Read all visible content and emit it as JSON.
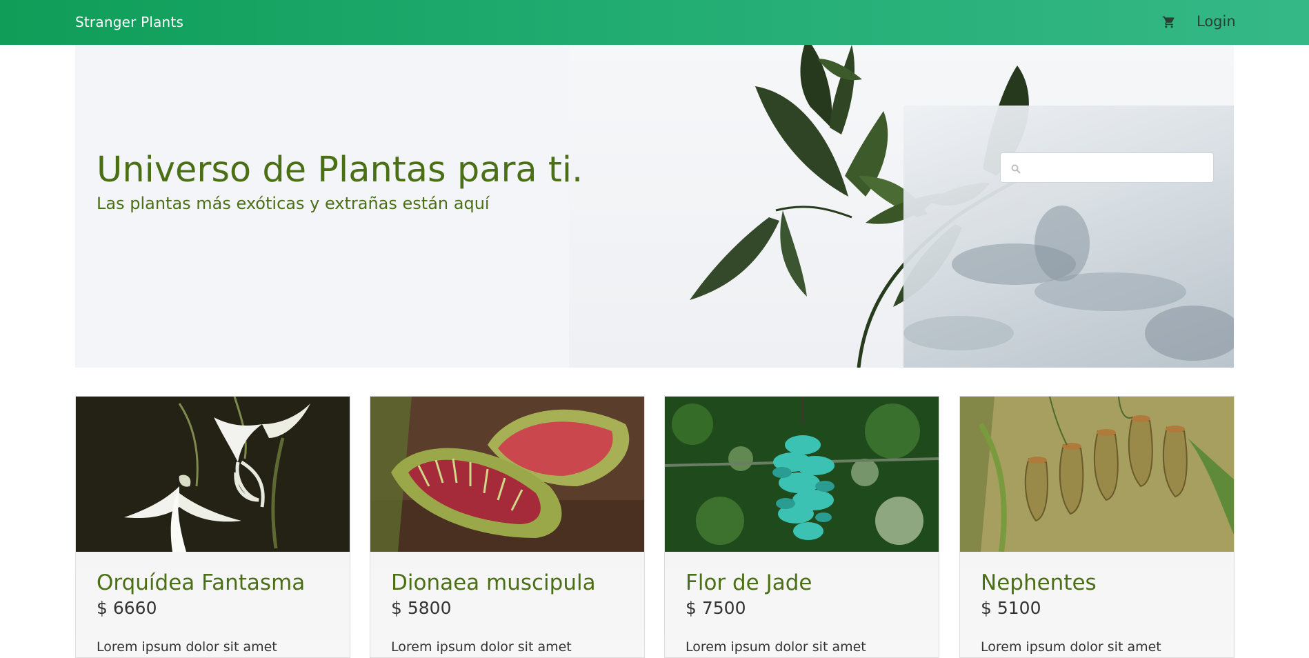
{
  "navbar": {
    "brand": "Stranger Plants",
    "cart_icon": "cart-icon",
    "login_label": "Login",
    "colors": {
      "start": "#0f9d58",
      "end": "#35b886"
    }
  },
  "hero": {
    "title": "Universo de Plantas para ti.",
    "subtitle": "Las plantas más exóticas y extrañas están aquí",
    "search": {
      "placeholder": "",
      "value": "",
      "icon": "search-icon"
    },
    "title_color": "#4a6f14"
  },
  "products": [
    {
      "name": "Orquídea Fantasma",
      "price": "$ 6660",
      "description": "Lorem ipsum dolor sit amet",
      "image": "ghost-orchid-photo"
    },
    {
      "name": "Dionaea muscipula",
      "price": "$ 5800",
      "description": "Lorem ipsum dolor sit amet",
      "image": "venus-flytrap-photo"
    },
    {
      "name": "Flor de Jade",
      "price": "$ 7500",
      "description": "Lorem ipsum dolor sit amet",
      "image": "jade-vine-photo"
    },
    {
      "name": "Nephentes",
      "price": "$ 5100",
      "description": "Lorem ipsum dolor sit amet",
      "image": "pitcher-plant-photo"
    }
  ]
}
